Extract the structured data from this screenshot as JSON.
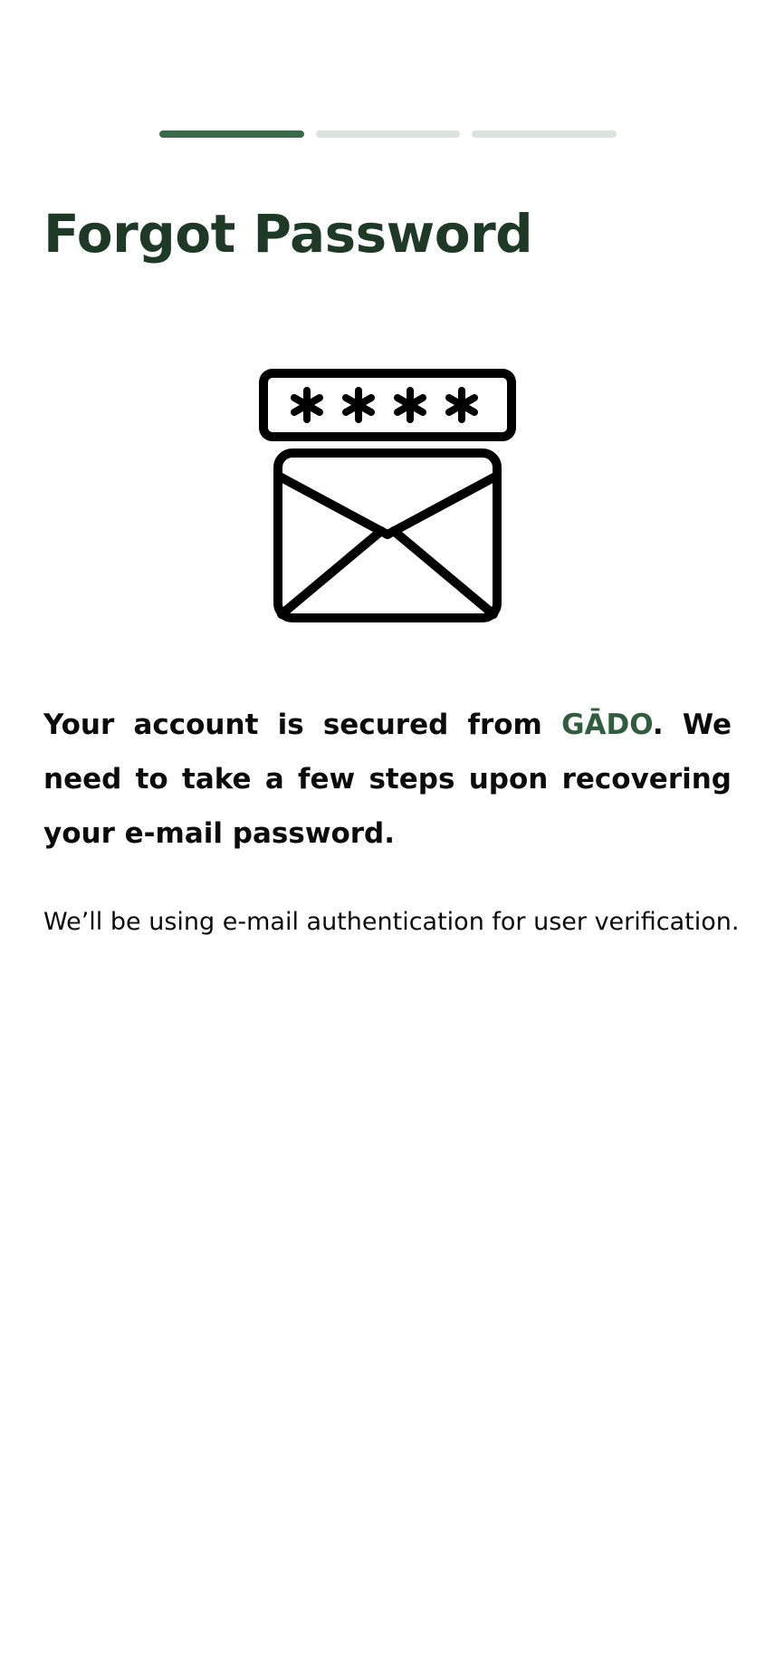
{
  "progress": {
    "total_steps": 3,
    "current_step": 1,
    "active_color": "#3a6a4b",
    "inactive_color": "#dde3dd"
  },
  "page": {
    "title": "Forgot Password"
  },
  "illustration": {
    "icon": "password-envelope-icon",
    "mask_text": "****"
  },
  "message": {
    "lead_part1": "Your account is secured from ",
    "brand_name": "GĀDO",
    "lead_part2": ". We need to take a few steps upon recovering your e-mail password.",
    "note": "We’ll be using e-mail authentication for user verification."
  },
  "colors": {
    "title": "#1e3a27",
    "brand": "#2f5d3d",
    "text": "#0b0b0b"
  }
}
